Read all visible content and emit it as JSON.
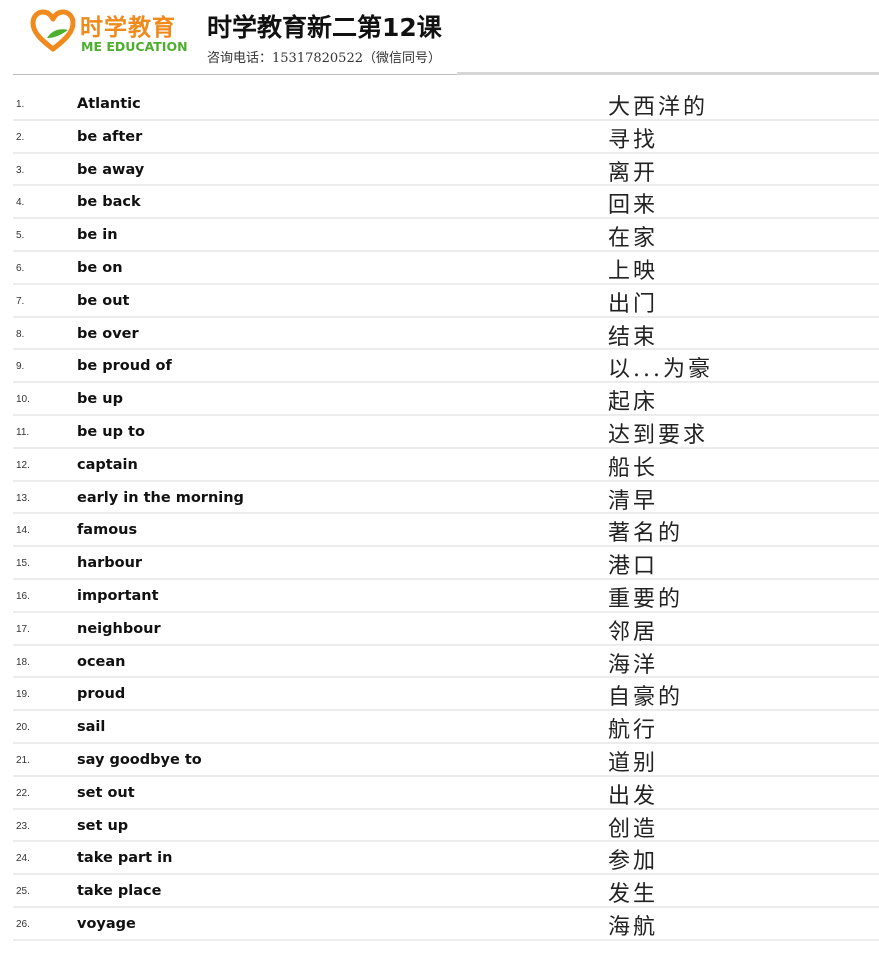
{
  "logo": {
    "chinese": "时学教育",
    "english": "ME EDUCATION",
    "heart_color": "#f08a1c",
    "leaf_color": "#4caf2d"
  },
  "header": {
    "title": "时学教育新二第12课",
    "contact": "咨询电话：15317820522（微信同号）"
  },
  "vocabulary": [
    {
      "num": "1.",
      "en": "Atlantic",
      "zh": "大西洋的"
    },
    {
      "num": "2.",
      "en": "be after",
      "zh": "寻找"
    },
    {
      "num": "3.",
      "en": "be away",
      "zh": "离开"
    },
    {
      "num": "4.",
      "en": "be back",
      "zh": "回来"
    },
    {
      "num": "5.",
      "en": "be in",
      "zh": "在家"
    },
    {
      "num": "6.",
      "en": "be on",
      "zh": "上映"
    },
    {
      "num": "7.",
      "en": "be out",
      "zh": "出门"
    },
    {
      "num": "8.",
      "en": "be over",
      "zh": "结束"
    },
    {
      "num": "9.",
      "en": "be proud of",
      "zh": "以...为豪"
    },
    {
      "num": "10.",
      "en": "be up",
      "zh": "起床"
    },
    {
      "num": "11.",
      "en": "be up to",
      "zh": "达到要求"
    },
    {
      "num": "12.",
      "en": "captain",
      "zh": "船长"
    },
    {
      "num": "13.",
      "en": "early in the morning",
      "zh": "清早"
    },
    {
      "num": "14.",
      "en": "famous",
      "zh": "著名的"
    },
    {
      "num": "15.",
      "en": "harbour",
      "zh": "港口"
    },
    {
      "num": "16.",
      "en": "important",
      "zh": "重要的"
    },
    {
      "num": "17.",
      "en": "neighbour",
      "zh": "邻居"
    },
    {
      "num": "18.",
      "en": "ocean",
      "zh": "海洋"
    },
    {
      "num": "19.",
      "en": "proud",
      "zh": "自豪的"
    },
    {
      "num": "20.",
      "en": "sail",
      "zh": "航行"
    },
    {
      "num": "21.",
      "en": "say goodbye to",
      "zh": "道别"
    },
    {
      "num": "22.",
      "en": "set out",
      "zh": "出发"
    },
    {
      "num": "23.",
      "en": "set up",
      "zh": "创造"
    },
    {
      "num": "24.",
      "en": "take part in",
      "zh": "参加"
    },
    {
      "num": "25.",
      "en": "take place",
      "zh": "发生"
    },
    {
      "num": "26.",
      "en": "voyage",
      "zh": "海航"
    }
  ]
}
